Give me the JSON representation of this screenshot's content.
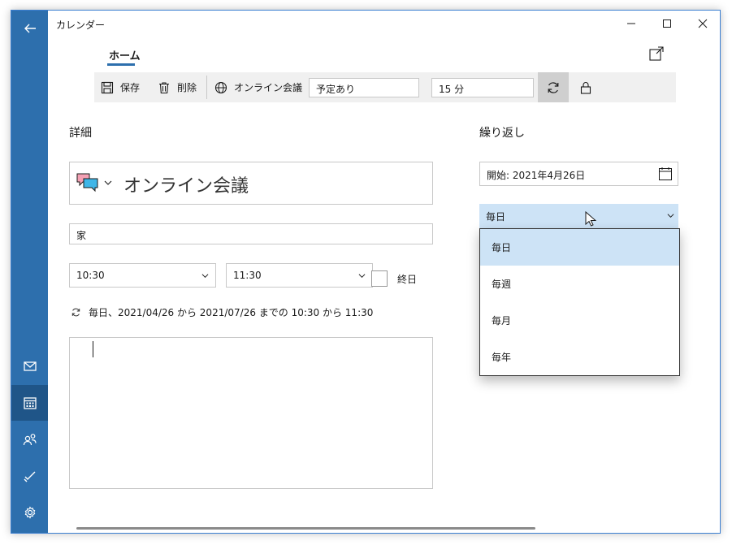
{
  "app": {
    "title": "カレンダー"
  },
  "tabs": {
    "home_label": "ホーム"
  },
  "toolbar": {
    "save_label": "保存",
    "delete_label": "削除",
    "online_meeting_label": "オンライン会議",
    "status_value": "予定あり",
    "reminder_value": "15 分"
  },
  "details": {
    "section_title": "詳細",
    "event_title": "オンライン会議",
    "location_value": "家",
    "start_time": "10:30",
    "end_time": "11:30",
    "all_day_label": "終日",
    "repeat_summary": "毎日、2021/04/26 から 2021/07/26 までの 10:30 から 11:30"
  },
  "repeat": {
    "section_title": "繰り返し",
    "start_label": "開始: 2021年4月26日",
    "frequency_value": "毎日",
    "options": [
      {
        "label": "毎日",
        "selected": true
      },
      {
        "label": "毎週",
        "selected": false
      },
      {
        "label": "毎月",
        "selected": false
      },
      {
        "label": "毎年",
        "selected": false
      }
    ]
  },
  "colors": {
    "rail": "#2d6fad",
    "rail_active": "#1f5588",
    "accent": "#2d6fad",
    "selection": "#cde3f6",
    "toolbar_bg": "#f0f0f0"
  },
  "icons": {
    "rail": [
      "back-arrow-icon",
      "mail-icon",
      "calendar-icon",
      "people-icon",
      "todo-icon",
      "settings-icon"
    ],
    "toolbar": [
      "save-icon",
      "trash-icon",
      "globe-icon",
      "repeat-icon",
      "lock-icon"
    ]
  }
}
